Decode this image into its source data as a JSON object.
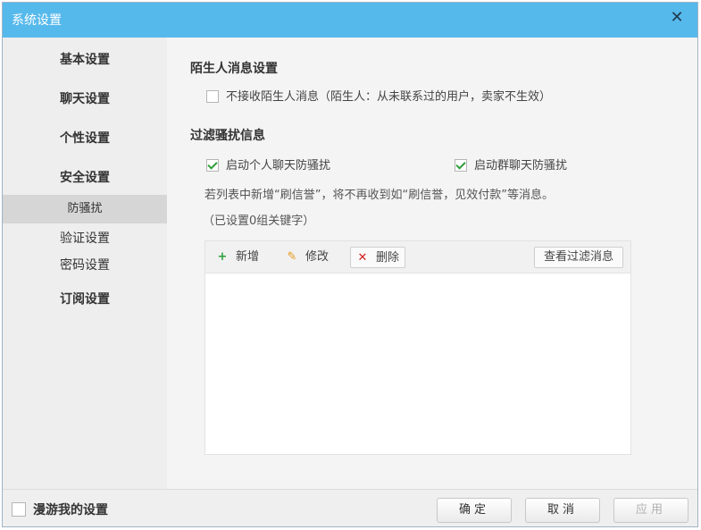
{
  "window": {
    "title": "系统设置",
    "close_glyph": "✕"
  },
  "sidebar": {
    "items": [
      {
        "label": "基本设置"
      },
      {
        "label": "聊天设置"
      },
      {
        "label": "个性设置"
      },
      {
        "label": "安全设置"
      },
      {
        "label": "防骚扰",
        "active": true
      },
      {
        "label": "验证设置"
      },
      {
        "label": "密码设置"
      },
      {
        "label": "订阅设置"
      }
    ]
  },
  "stranger": {
    "title": "陌生人消息设置",
    "option_label": "不接收陌生人消息（陌生人：从未联系过的用户，卖家不生效）",
    "option_checked": false
  },
  "filter": {
    "title": "过滤骚扰信息",
    "personal_label": "启动个人聊天防骚扰",
    "personal_checked": true,
    "group_label": "启动群聊天防骚扰",
    "group_checked": true,
    "hint": "若列表中新增“刷信誉”，将不再收到如“刷信誉，见效付款”等消息。",
    "count_text": "（已设置0组关键字）",
    "toolbar": {
      "add_label": "新增",
      "edit_label": "修改",
      "delete_label": "删除",
      "view_label": "查看过滤消息"
    }
  },
  "footer": {
    "roam_label": "漫游我的设置",
    "roam_checked": false,
    "ok_label": "确定",
    "cancel_label": "取消",
    "apply_label": "应用"
  },
  "colors": {
    "titlebar": "#56b9ec",
    "check_green": "#2e9e3a",
    "delete_red": "#d21f1f",
    "edit_orange": "#e69a1a"
  },
  "icons": {
    "add": "plus-icon",
    "edit": "pencil-icon",
    "delete": "x-icon",
    "close": "close-icon"
  }
}
